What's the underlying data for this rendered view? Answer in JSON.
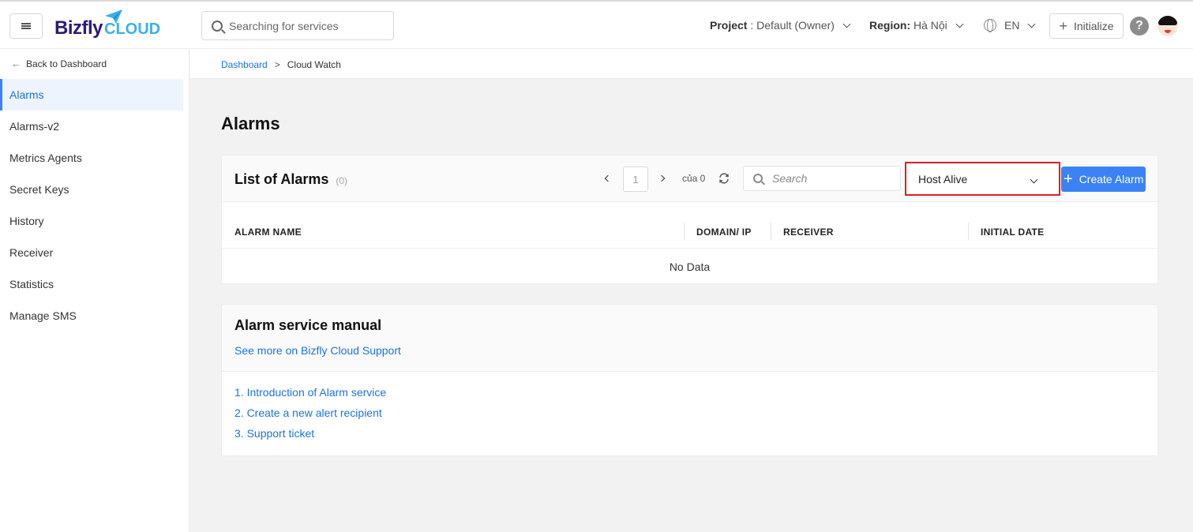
{
  "header": {
    "logo_main": "Bizfly",
    "logo_sub": "CLOUD",
    "search_placeholder": "Searching for services",
    "project_label": "Project",
    "project_value": " : Default (Owner)",
    "region_label": "Region:",
    "region_value": " Hà Nội",
    "language": "EN",
    "initialize_label": "Initialize",
    "help_glyph": "?"
  },
  "sidebar": {
    "back_label": "Back to Dashboard",
    "items": [
      {
        "label": "Alarms"
      },
      {
        "label": "Alarms-v2"
      },
      {
        "label": "Metrics Agents"
      },
      {
        "label": "Secret Keys"
      },
      {
        "label": "History"
      },
      {
        "label": "Receiver"
      },
      {
        "label": "Statistics"
      },
      {
        "label": "Manage SMS"
      }
    ]
  },
  "breadcrumb": {
    "root": "Dashboard",
    "separator": ">",
    "current": "Cloud Watch"
  },
  "page": {
    "title": "Alarms"
  },
  "alarms": {
    "title": "List of Alarms",
    "count": "(0)",
    "page": "1",
    "of_text": "của 0",
    "search_placeholder": "Search",
    "filter_value": "Host Alive",
    "create_label": "Create Alarm",
    "columns": [
      "ALARM NAME",
      "DOMAIN/ IP",
      "RECEIVER",
      "INITIAL DATE"
    ],
    "empty_text": "No Data"
  },
  "manual": {
    "title": "Alarm service manual",
    "support_link": "See more on Bizfly Cloud Support",
    "links": [
      "1. Introduction of Alarm service",
      "2. Create a new alert recipient",
      "3. Support ticket"
    ]
  },
  "colors": {
    "accent": "#3b82f6",
    "link": "#1a73e8",
    "highlight_border": "#e02020"
  }
}
